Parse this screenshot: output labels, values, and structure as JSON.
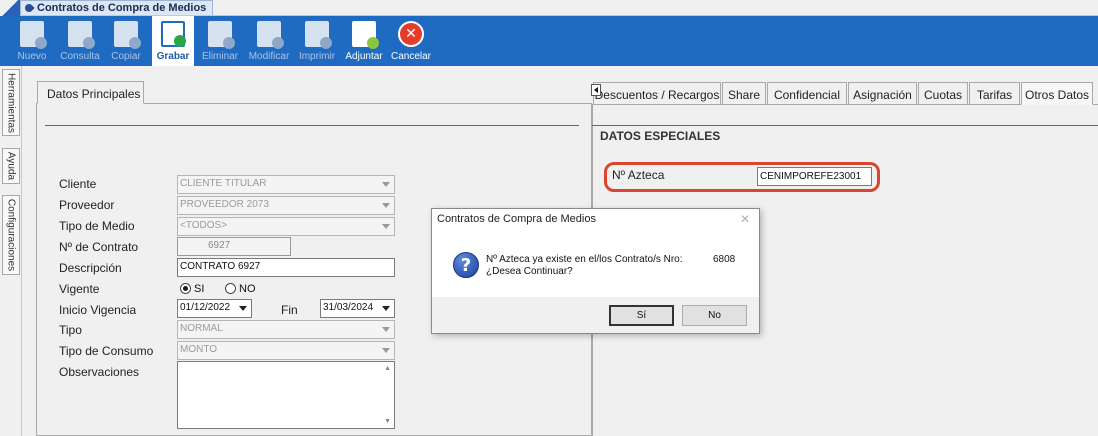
{
  "window": {
    "tab_title": "Contratos de Compra de Medios"
  },
  "toolbar": {
    "buttons": [
      {
        "label": "Nuevo",
        "icon": "new-document-icon",
        "state": "disabled"
      },
      {
        "label": "Consulta",
        "icon": "query-document-icon",
        "state": "disabled"
      },
      {
        "label": "Copiar",
        "icon": "copy-icon",
        "state": "disabled"
      },
      {
        "label": "Grabar",
        "icon": "save-icon",
        "state": "active"
      },
      {
        "label": "Eliminar",
        "icon": "delete-document-icon",
        "state": "disabled"
      },
      {
        "label": "Modificar",
        "icon": "edit-document-icon",
        "state": "disabled"
      },
      {
        "label": "Imprimir",
        "icon": "printer-icon",
        "state": "disabled"
      },
      {
        "label": "Adjuntar",
        "icon": "attach-document-icon",
        "state": "enabled"
      },
      {
        "label": "Cancelar",
        "icon": "cancel-icon",
        "state": "enabled"
      }
    ]
  },
  "side_tabs": [
    "Herramientas",
    "Ayuda",
    "Configuraciones"
  ],
  "left_panel": {
    "tab": "Datos Principales",
    "fields": {
      "cliente": {
        "label": "Cliente",
        "value": "CLIENTE TITULAR"
      },
      "proveedor": {
        "label": "Proveedor",
        "value": "PROVEEDOR 2073"
      },
      "tipo_medio": {
        "label": "Tipo de Medio",
        "value": "<TODOS>"
      },
      "numero_contrato": {
        "label": "Nº de Contrato",
        "value": "6927"
      },
      "descripcion": {
        "label": "Descripción",
        "value": "CONTRATO 6927"
      },
      "vigente": {
        "label": "Vigente",
        "option_si": "SI",
        "option_no": "NO",
        "selected": "SI"
      },
      "inicio_vigencia": {
        "label": "Inicio Vigencia",
        "value": "01/12/2022"
      },
      "fin": {
        "label": "Fin",
        "value": "31/03/2024"
      },
      "tipo": {
        "label": "Tipo",
        "value": "NORMAL"
      },
      "tipo_consumo": {
        "label": "Tipo de Consumo",
        "value": "MONTO"
      },
      "observaciones": {
        "label": "Observaciones",
        "value": ""
      }
    }
  },
  "right_panel": {
    "tabs": [
      "Descuentos / Recargos",
      "Share",
      "Confidencial",
      "Asignación",
      "Cuotas",
      "Tarifas",
      "Otros Datos"
    ],
    "selected_tab": "Otros Datos",
    "section_title": "DATOS ESPECIALES",
    "azteca_label": "Nº Azteca",
    "azteca_value": "CENIMPOREFE23001",
    "highlight_color": "#d9452f"
  },
  "dialog": {
    "title": "Contratos de Compra de Medios",
    "message_line1": "Nº Azteca ya existe en el/los Contrato/s Nro:",
    "contract_number": "6808",
    "message_line2": "¿Desea Continuar?",
    "icon": "question-icon",
    "yes_label": "Sí",
    "no_label": "No"
  },
  "colors": {
    "toolbar": "#1f6bc1",
    "accent": "#4a6aa0"
  }
}
